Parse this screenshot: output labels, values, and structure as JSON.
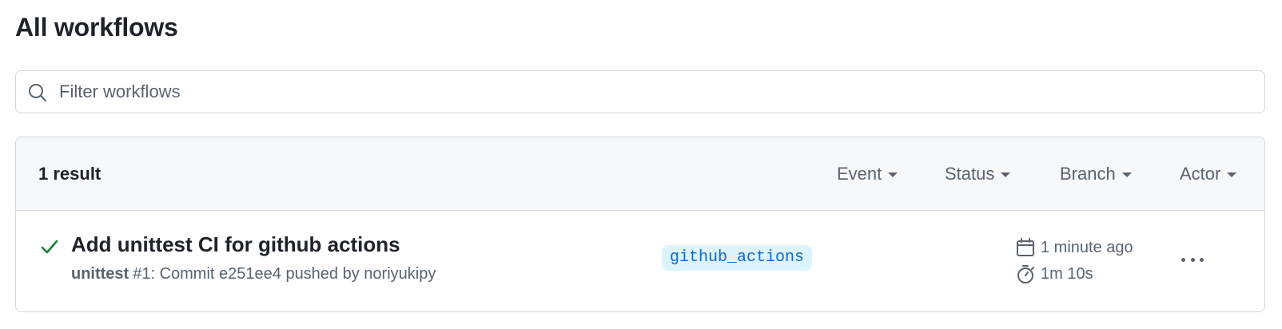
{
  "page": {
    "title": "All workflows"
  },
  "search": {
    "placeholder": "Filter workflows",
    "value": ""
  },
  "results": {
    "count_label": "1 result",
    "filters": [
      {
        "label": "Event"
      },
      {
        "label": "Status"
      },
      {
        "label": "Branch"
      },
      {
        "label": "Actor"
      }
    ],
    "runs": [
      {
        "status": "success",
        "title": "Add unittest CI for github actions",
        "workflow": "unittest",
        "meta": "#1: Commit e251ee4 pushed by noriyukipy",
        "branch": "github_actions",
        "time_ago": "1 minute ago",
        "duration": "1m 10s"
      }
    ]
  },
  "icons": {
    "search": "search-icon",
    "status": "check-icon",
    "calendar": "calendar-icon",
    "stopwatch": "stopwatch-icon",
    "more": "kebab-horizontal-icon",
    "caret": "caret-down-icon"
  },
  "colors": {
    "success": "#1a7f37",
    "branch_bg": "#ddf4ff",
    "branch_text": "#0969da",
    "muted": "#59636e",
    "border": "#d0d7de",
    "header_bg": "#f6f8fa"
  }
}
